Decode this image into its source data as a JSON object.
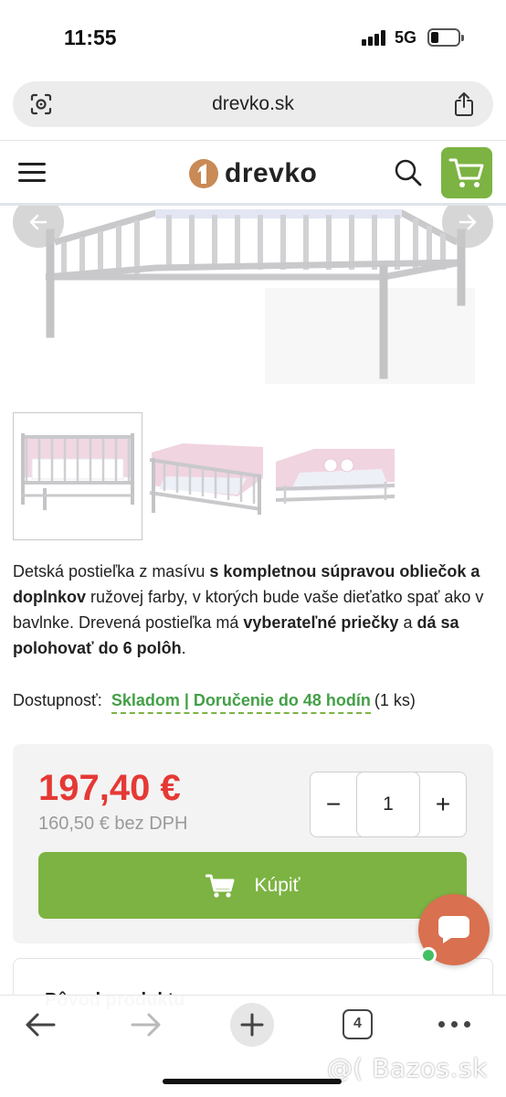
{
  "status_bar": {
    "time": "11:55",
    "network": "5G"
  },
  "browser": {
    "url": "drevko.sk",
    "tab_count": "4"
  },
  "header": {
    "logo_text": "drevko",
    "brand_color": "#7cb342"
  },
  "product": {
    "description_parts": [
      {
        "text": "Detská postieľka z masívu ",
        "bold": false
      },
      {
        "text": "s kompletnou súpravou obliečok a doplnkov",
        "bold": true
      },
      {
        "text": " ružovej farby, v ktorých bude vaše dieťatko spať ako v bavlnke. Drevená postieľka má ",
        "bold": false
      },
      {
        "text": "vyberateľné priečky",
        "bold": true
      },
      {
        "text": " a ",
        "bold": false
      },
      {
        "text": "dá sa polohovať do 6 polôh",
        "bold": true
      },
      {
        "text": ".",
        "bold": false
      }
    ],
    "availability_label": "Dostupnosť:",
    "availability_value": "Skladom | Doručenie do 48 hodín",
    "availability_qty": "(1 ks)",
    "price": "197,40 €",
    "price_net": "160,50 € bez DPH",
    "quantity": "1",
    "minus_label": "−",
    "plus_label": "+",
    "buy_label": "Kúpiť",
    "next_section_title": "Pôvod produktu"
  },
  "watermark": "@( Bazos.sk",
  "icons": [
    "lens-icon",
    "share-icon",
    "hamburger-icon",
    "logo-icon",
    "search-icon",
    "cart-icon",
    "chevron-left-icon",
    "chevron-right-icon",
    "chat-icon",
    "back-icon",
    "forward-icon",
    "plus-icon",
    "more-icon"
  ],
  "colors": {
    "accent_green": "#7cb342",
    "price_red": "#e53935",
    "stock_green": "#43a047",
    "chat_orange": "#d9704f"
  }
}
